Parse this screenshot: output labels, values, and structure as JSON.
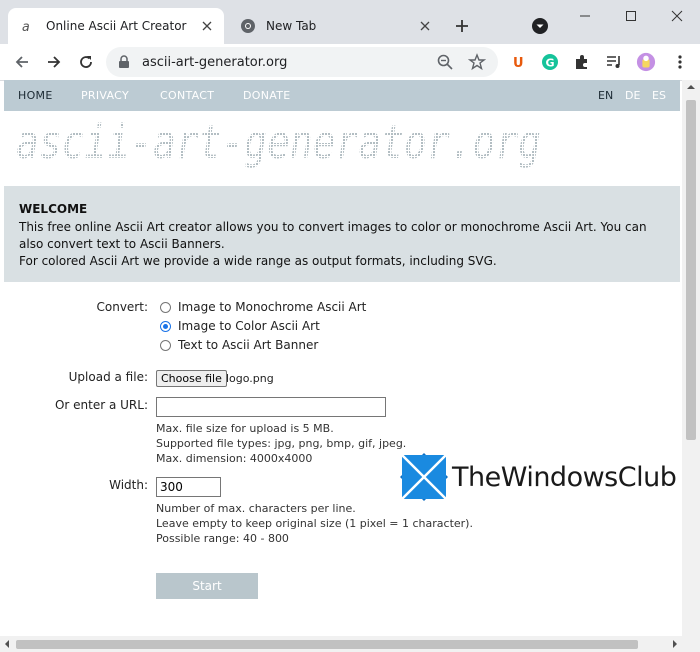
{
  "browser": {
    "tabs": [
      {
        "title": "Online Ascii Art Creator",
        "active": true
      },
      {
        "title": "New Tab",
        "active": false
      }
    ],
    "url": "ascii-art-generator.org",
    "colors": {
      "tabstrip": "#dee1e6",
      "omnibox": "#f1f3f4"
    }
  },
  "nav": {
    "items": [
      "HOME",
      "PRIVACY",
      "CONTACT",
      "DONATE"
    ],
    "languages": [
      "EN",
      "DE",
      "ES"
    ]
  },
  "logo_text": "ascii-art-generator.org",
  "welcome": {
    "heading": "WELCOME",
    "line1": "This free online Ascii Art creator allows you to convert images to color or monochrome Ascii Art. You can",
    "line2": "also convert text to Ascii Banners.",
    "line3": "For colored Ascii Art we provide a wide range as output formats, including SVG."
  },
  "form": {
    "convert_label": "Convert:",
    "options": [
      "Image to Monochrome Ascii Art",
      "Image to Color Ascii Art",
      "Text to Ascii Art Banner"
    ],
    "selected_index": 1,
    "upload_label": "Upload a file:",
    "choose_button": "Choose file",
    "file_name": "logo.png",
    "url_label": "Or enter a URL:",
    "url_value": "",
    "upload_help": [
      "Max. file size for upload is 5 MB.",
      "Supported file types: jpg, png, bmp, gif, jpeg.",
      "Max. dimension: 4000x4000"
    ],
    "width_label": "Width:",
    "width_value": "300",
    "width_help": [
      "Number of max. characters per line.",
      "Leave empty to keep original size (1 pixel = 1 character).",
      "Possible range: 40 - 800"
    ],
    "start_button": "Start"
  },
  "watermark": "TheWindowsClub"
}
